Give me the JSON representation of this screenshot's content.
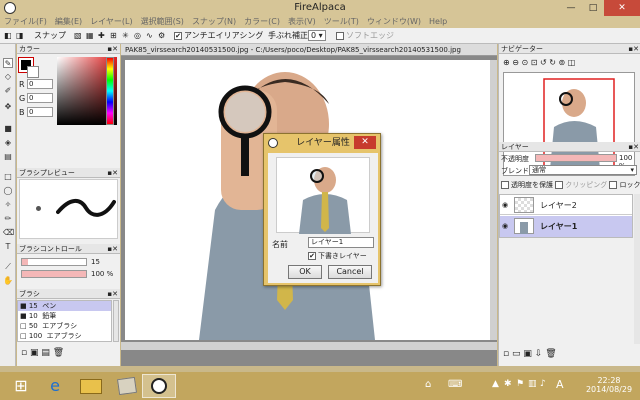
{
  "window": {
    "title": "FireAlpaca",
    "minimize": "—",
    "maximize": "□",
    "close": "✕"
  },
  "menu": [
    "ファイル(F)",
    "編集(E)",
    "レイヤー(L)",
    "選択範囲(S)",
    "スナップ(N)",
    "カラー(C)",
    "表示(V)",
    "ツール(T)",
    "ウィンドウ(W)",
    "Help"
  ],
  "toolbar": {
    "snap_label": "スナップ",
    "antialias_label": "アンチエイリアシング",
    "antialias_checked": "✔",
    "stabilizer_label": "手ぶれ補正",
    "stabilizer_value": "0",
    "soft_edge_label": "ソフトエッジ"
  },
  "color_panel": {
    "title": "カラー",
    "r_label": "R",
    "r_value": "0",
    "g_label": "G",
    "g_value": "0",
    "b_label": "B",
    "b_value": "0"
  },
  "brush_preview": {
    "title": "ブラシプレビュー"
  },
  "brush_control": {
    "title": "ブラシコントロール",
    "size_value": "15",
    "opacity_value": "100 %",
    "size_fraction": 0.1,
    "opacity_fraction": 1.0
  },
  "brush_panel": {
    "title": "ブラシ",
    "items": [
      {
        "size": "15",
        "name": "ペン"
      },
      {
        "size": "10",
        "name": "鉛筆"
      },
      {
        "size": "50",
        "name": "エアブラシ"
      },
      {
        "size": "100",
        "name": "エアブラシ"
      }
    ]
  },
  "document": {
    "tab_label": "PAK85_virssearch20140531500.jpg - C:/Users/poco/Desktop/PAK85_virssearch20140531500.jpg"
  },
  "navigator": {
    "title": "ナビゲーター"
  },
  "layer_panel": {
    "title": "レイヤー",
    "opacity_label": "不透明度",
    "opacity_value": "100 %",
    "opacity_fraction": 1.0,
    "blend_label": "ブレンド",
    "blend_value": "通常",
    "protect_label": "透明度を保護",
    "clipping_label": "クリッピング",
    "lock_label": "ロック",
    "layers": [
      {
        "name": "レイヤー2"
      },
      {
        "name": "レイヤー1"
      }
    ]
  },
  "dialog": {
    "title": "レイヤー属性",
    "close": "✕",
    "name_label": "名前",
    "name_value": "レイヤー1",
    "draft_label": "下書きレイヤー",
    "draft_checked": "✔",
    "ok_label": "OK",
    "cancel_label": "Cancel"
  },
  "taskbar": {
    "time": "22:28",
    "date": "2014/08/29",
    "ime": "A"
  },
  "colors": {
    "titlebar": "#d6c597",
    "close_red": "#c74a3a",
    "accent_pink": "#f4b7b7",
    "selection": "#c8c8f0",
    "taskbar": "#c2a65e"
  }
}
